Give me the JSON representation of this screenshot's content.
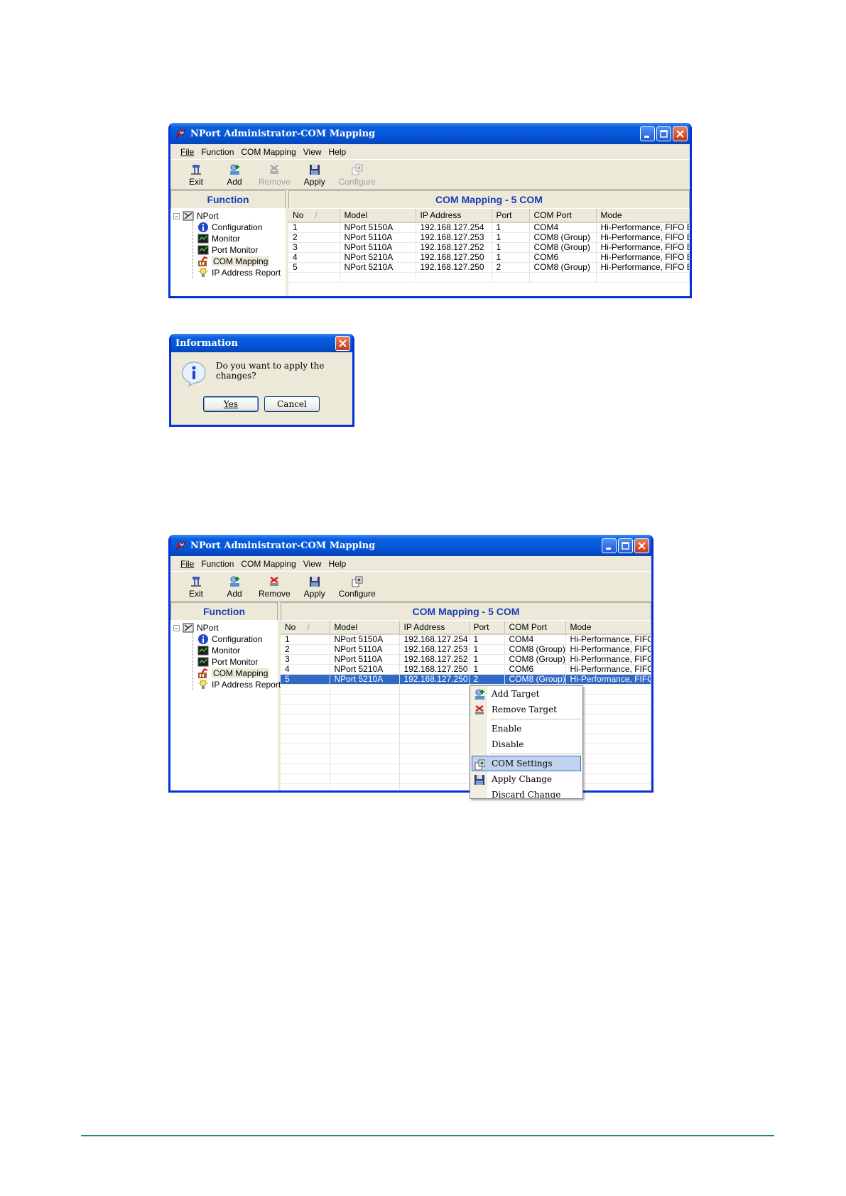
{
  "window_title": "NPort Administrator-COM Mapping",
  "menu": [
    "File",
    "Function",
    "COM Mapping",
    "View",
    "Help"
  ],
  "toolbar": {
    "exit": "Exit",
    "add": "Add",
    "remove": "Remove",
    "apply": "Apply",
    "configure": "Configure"
  },
  "function_panel_title": "Function",
  "tree": {
    "root": "NPort",
    "children": [
      "Configuration",
      "Monitor",
      "Port Monitor",
      "COM Mapping",
      "IP Address Report"
    ]
  },
  "list_title": "COM Mapping - 5 COM",
  "columns": [
    "No",
    "Model",
    "IP Address",
    "Port",
    "COM Port",
    "Mode"
  ],
  "rows": [
    [
      "1",
      "NPort 5150A",
      "192.168.127.254",
      "1",
      "COM4",
      "Hi-Performance, FIFO E"
    ],
    [
      "2",
      "NPort 5110A",
      "192.168.127.253",
      "1",
      "COM8 (Group)",
      "Hi-Performance, FIFO E"
    ],
    [
      "3",
      "NPort 5110A",
      "192.168.127.252",
      "1",
      "COM8 (Group)",
      "Hi-Performance, FIFO E"
    ],
    [
      "4",
      "NPort 5210A",
      "192.168.127.250",
      "1",
      "COM6",
      "Hi-Performance, FIFO E"
    ],
    [
      "5",
      "NPort 5210A",
      "192.168.127.250",
      "2",
      "COM8 (Group)",
      "Hi-Performance, FIFO E"
    ]
  ],
  "sort_indicator": "/",
  "dialog": {
    "title": "Information",
    "message": "Do you want to apply the changes?",
    "yes": "Yes",
    "cancel": "Cancel"
  },
  "context_menu": {
    "add_target": "Add Target",
    "remove_target": "Remove Target",
    "enable": "Enable",
    "disable": "Disable",
    "com_settings": "COM Settings",
    "apply_change": "Apply Change",
    "discard_change": "Discard Change"
  },
  "colors": {
    "xp_blue": "#0831d9",
    "panel_title": "#1c3bb8",
    "selection": "#316ac5",
    "footer_rule": "#1a8a73"
  }
}
